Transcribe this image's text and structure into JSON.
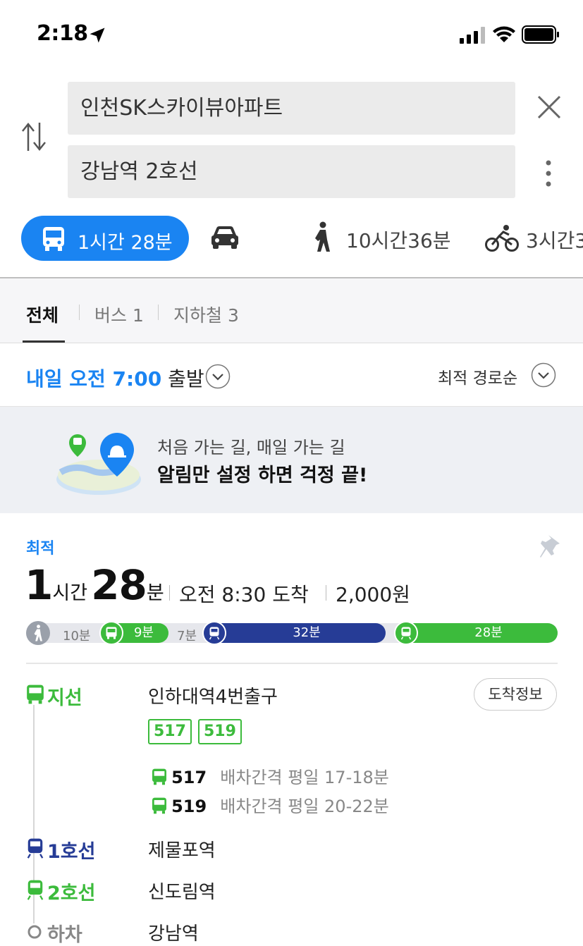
{
  "status_bar": {
    "time": "2:18"
  },
  "search": {
    "origin": "인천SK스카이뷰아파트",
    "destination": "강남역 2호선"
  },
  "modes": {
    "transit": "1시간 28분",
    "walk": "10시간36분",
    "bike": "3시간3"
  },
  "subtabs": {
    "all": "전체",
    "bus": "버스 1",
    "subway": "지하철 3"
  },
  "depart": {
    "time": "내일 오전 7:00",
    "suffix": " 출발",
    "sort": "최적 경로순"
  },
  "banner": {
    "line1": "처음 가는 길, 매일 가는 길",
    "line2": "알림만 설정 하면 걱정 끝!"
  },
  "route": {
    "badge": "최적",
    "hours": "1",
    "hours_unit": "시간",
    "minutes": "28",
    "minutes_unit": "분",
    "arrival": "오전 8:30 도착",
    "fare": "2,000원",
    "timeline": {
      "walk": "10분",
      "bus": "9분",
      "transfer": "7분",
      "subway1": "32분",
      "subway2": "28분"
    },
    "steps": [
      {
        "line": "지선",
        "stop": "인하대역4번출구",
        "color": "#3cbb3c"
      },
      {
        "line": "1호선",
        "stop": "제물포역",
        "color": "#263c96"
      },
      {
        "line": "2호선",
        "stop": "신도림역",
        "color": "#3cbb3c"
      },
      {
        "line": "하차",
        "stop": "강남역",
        "color": "#999999"
      }
    ],
    "arrival_info": "도착정보",
    "bus_chips": [
      "517",
      "519"
    ],
    "intervals": [
      {
        "bus": "517",
        "text": "배차간격 평일 17-18분"
      },
      {
        "bus": "519",
        "text": "배차간격 평일 20-22분"
      }
    ]
  },
  "colors": {
    "accent": "#1a84f2",
    "bus_green": "#3cbb3c",
    "line1_navy": "#263c96"
  }
}
